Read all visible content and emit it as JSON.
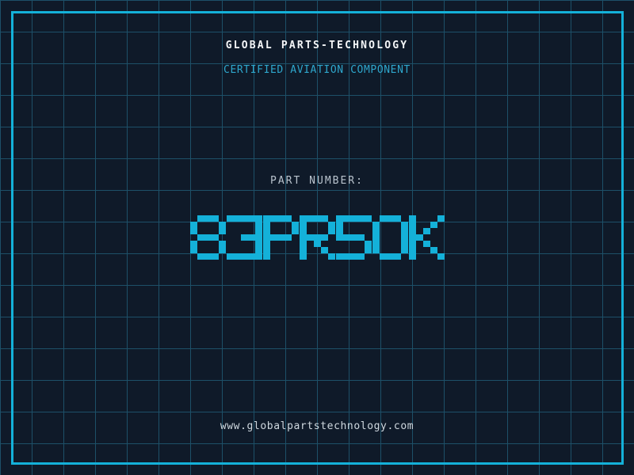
{
  "header": {
    "title": "GLOBAL PARTS-TECHNOLOGY",
    "subtitle": "CERTIFIED AVIATION COMPONENT"
  },
  "part": {
    "label": "PART NUMBER:",
    "value": "83PR5OK"
  },
  "footer": {
    "url": "www.globalpartstechnology.com"
  },
  "colors": {
    "background": "#0f1a29",
    "grid_line": "#1d5068",
    "accent": "#14b1d9",
    "title_text": "#f4f6f8",
    "subtitle_text": "#2ea7cd",
    "label_text": "#b9c3cd",
    "url_text": "#cfd8df"
  }
}
